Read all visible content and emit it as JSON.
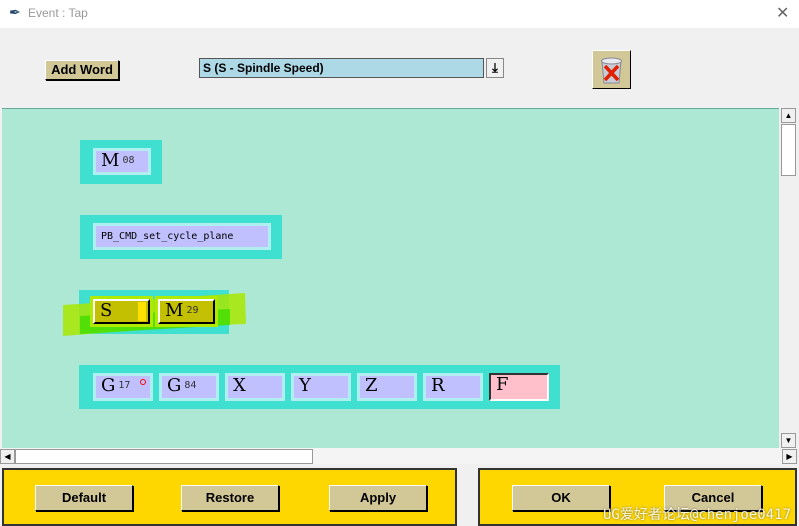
{
  "window": {
    "title": "Event : Tap",
    "icon": "feather-icon",
    "close": "✕"
  },
  "toolbar": {
    "add_word_label": "Add Word",
    "combo_value": "S (S - Spindle Speed)",
    "combo_arrow": "⤓",
    "trash_icon": "trash-delete-icon"
  },
  "canvas": {
    "groups": [
      {
        "words": [
          {
            "letter": "M",
            "sub": "08"
          }
        ]
      },
      {
        "words": [
          {
            "letter": "PB_CMD_set_cycle_plane",
            "sub": ""
          }
        ]
      },
      {
        "words": [
          {
            "letter": "S",
            "sub": ""
          },
          {
            "letter": "M",
            "sub": "29"
          }
        ],
        "selected": true
      },
      {
        "words": [
          {
            "letter": "G",
            "sub": "17"
          },
          {
            "letter": "G",
            "sub": "84"
          },
          {
            "letter": "X",
            "sub": ""
          },
          {
            "letter": "Y",
            "sub": ""
          },
          {
            "letter": "Z",
            "sub": ""
          },
          {
            "letter": "R",
            "sub": ""
          },
          {
            "letter": "F",
            "sub": ""
          }
        ]
      }
    ],
    "colors": {
      "background": "#ade8d4",
      "group": "#40e0d0",
      "word": "#c0c0ff",
      "selected": "#c2c000",
      "pink": "#ffc0cb"
    }
  },
  "buttons": {
    "default": "Default",
    "restore": "Restore",
    "apply": "Apply",
    "ok": "OK",
    "cancel": "Cancel"
  },
  "watermark": "UG爱好者论坛@chenjoe0417"
}
